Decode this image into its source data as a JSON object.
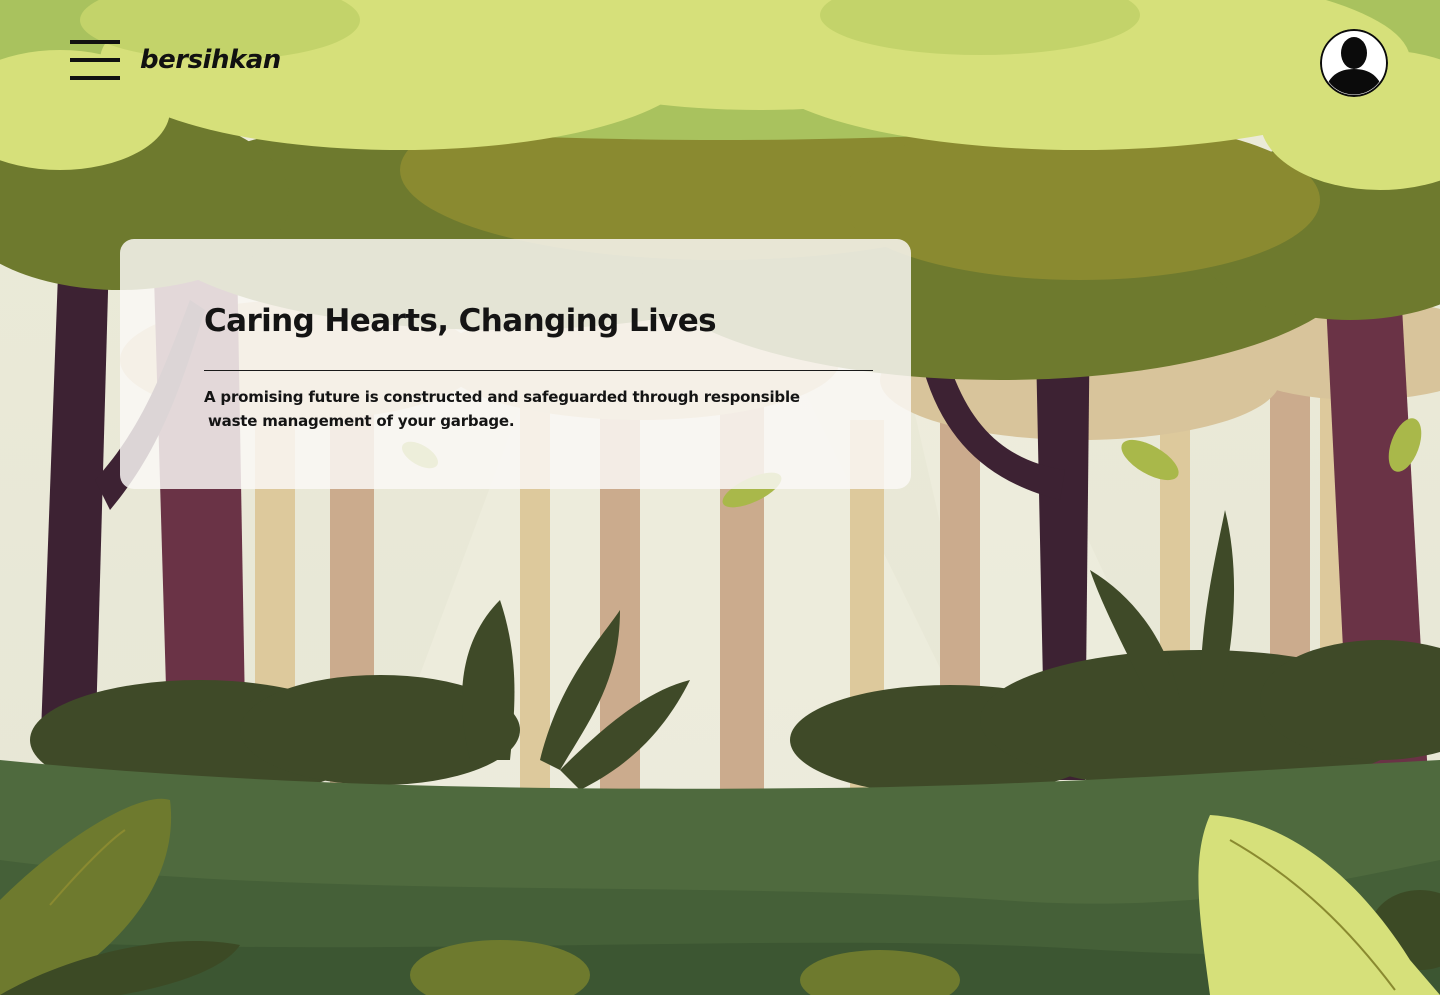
{
  "header": {
    "brand": "bersihkan",
    "menu_icon": "hamburger-menu-icon",
    "avatar_icon": "user-avatar-icon"
  },
  "hero": {
    "title": "Caring Hearts, Changing Lives",
    "text_line1": "A promising future is constructed and safeguarded through responsible",
    "text_line2": "waste management of your garbage."
  },
  "colors": {
    "canopy_light": "#d6e07a",
    "canopy_mid": "#a9c25e",
    "canopy_dark": "#6e7a2e",
    "trunk_purple": "#5a2f3e",
    "trunk_tan": "#cbab8d",
    "bush_dark": "#3f4a28",
    "ground_green": "#4f6a3e",
    "sky": "#eae9da"
  }
}
